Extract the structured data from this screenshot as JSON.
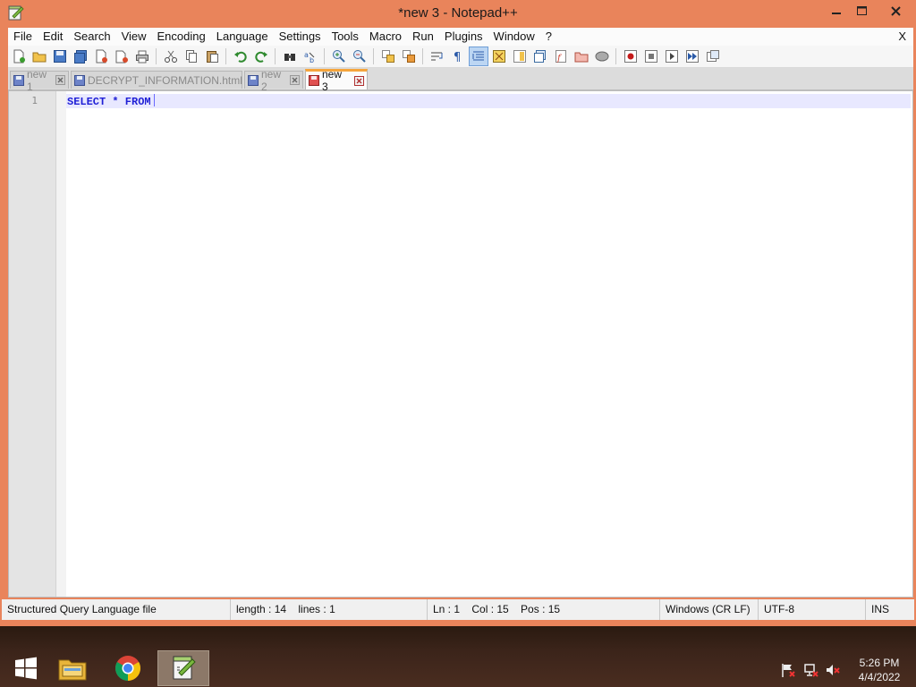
{
  "window": {
    "title": "*new 3 - Notepad++",
    "menu_close": "X"
  },
  "menu": {
    "items": [
      "File",
      "Edit",
      "Search",
      "View",
      "Encoding",
      "Language",
      "Settings",
      "Tools",
      "Macro",
      "Run",
      "Plugins",
      "Window",
      "?"
    ]
  },
  "tabs": [
    {
      "label": "new 1",
      "active": false
    },
    {
      "label": "DECRYPT_INFORMATION.html",
      "active": false
    },
    {
      "label": "new 2",
      "active": false
    },
    {
      "label": "new 3",
      "active": true
    }
  ],
  "editor": {
    "line_number": "1",
    "code": "SELECT * FROM",
    "keyword_color": "#1f1fd6"
  },
  "statusbar": {
    "file_type": "Structured Query Language file",
    "length": "length : 14    lines : 1",
    "position": "Ln : 1    Col : 15    Pos : 15",
    "eol": "Windows (CR LF)",
    "encoding": "UTF-8",
    "mode": "INS"
  },
  "taskbar": {
    "time": "5:26 PM",
    "date": "4/4/2022"
  },
  "colors": {
    "frame": "#e9845b",
    "active_tab_accent": "#f5a53c"
  }
}
